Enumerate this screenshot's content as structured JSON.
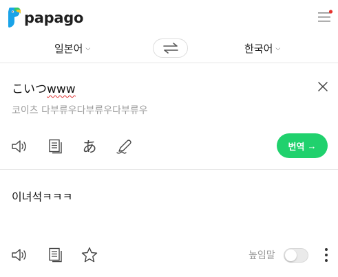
{
  "header": {
    "logo_text": "papago",
    "menu_icon": "hamburger-icon",
    "notification_color": "#e5322d"
  },
  "languages": {
    "source": "일본어",
    "target": "한국어",
    "swap_icon": "swap-arrows-icon"
  },
  "source": {
    "text_plain": "こいつ",
    "text_misspelled": "www",
    "pronunciation": "코이츠 다부류우다부류우다부류우",
    "icons": [
      "speaker-icon",
      "copy-icon",
      "handwriting-icon",
      "pen-icon"
    ],
    "kana_glyph": "あ",
    "translate_label": "번역",
    "translate_arrow": "→",
    "translate_color": "#20d16d"
  },
  "target": {
    "text": "이녀석ㅋㅋㅋ",
    "honorific_label": "높임말",
    "honorific_on": false,
    "icons": [
      "speaker-icon",
      "copy-icon",
      "star-icon",
      "more-vertical-icon"
    ]
  }
}
